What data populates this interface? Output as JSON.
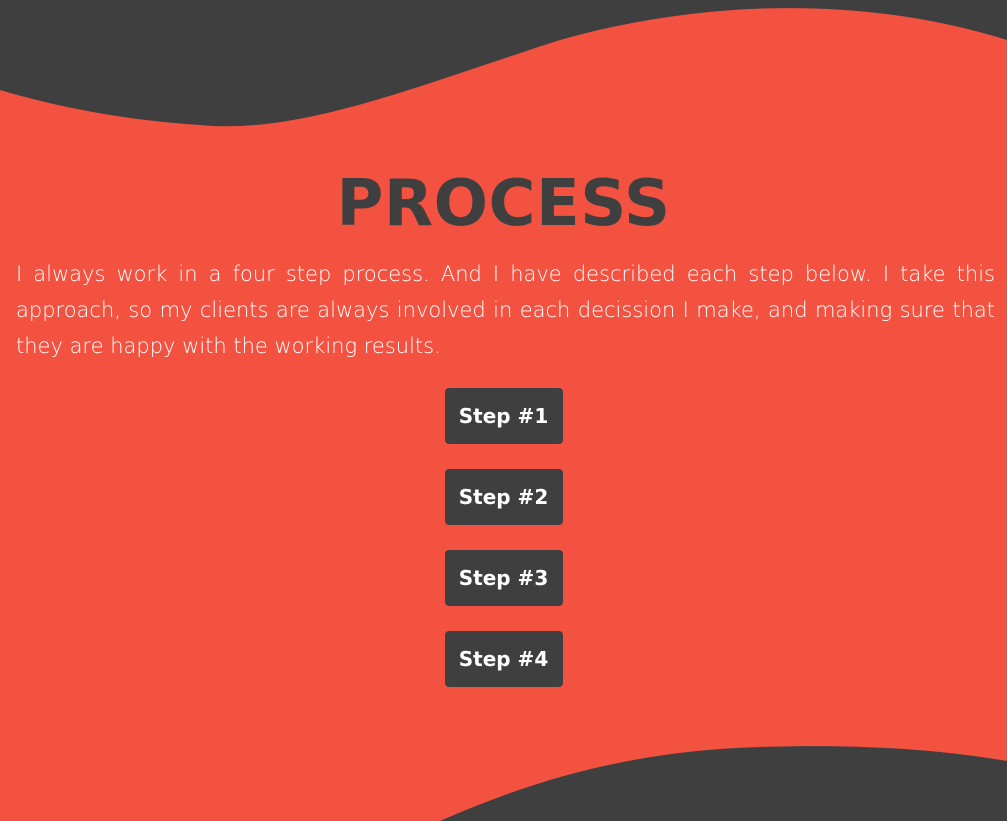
{
  "section": {
    "title": "PROCESS",
    "intro": "I always work in a four step process. And I have described each step below. I take this approach, so my clients are always involved in each decission I make, and making sure that they are happy with the working results."
  },
  "steps": [
    {
      "label": "Step #1"
    },
    {
      "label": "Step #2"
    },
    {
      "label": "Step #3"
    },
    {
      "label": "Step #4"
    }
  ],
  "colors": {
    "background": "#f35241",
    "dark": "#3f3f3f",
    "text_light": "#ffffff"
  }
}
